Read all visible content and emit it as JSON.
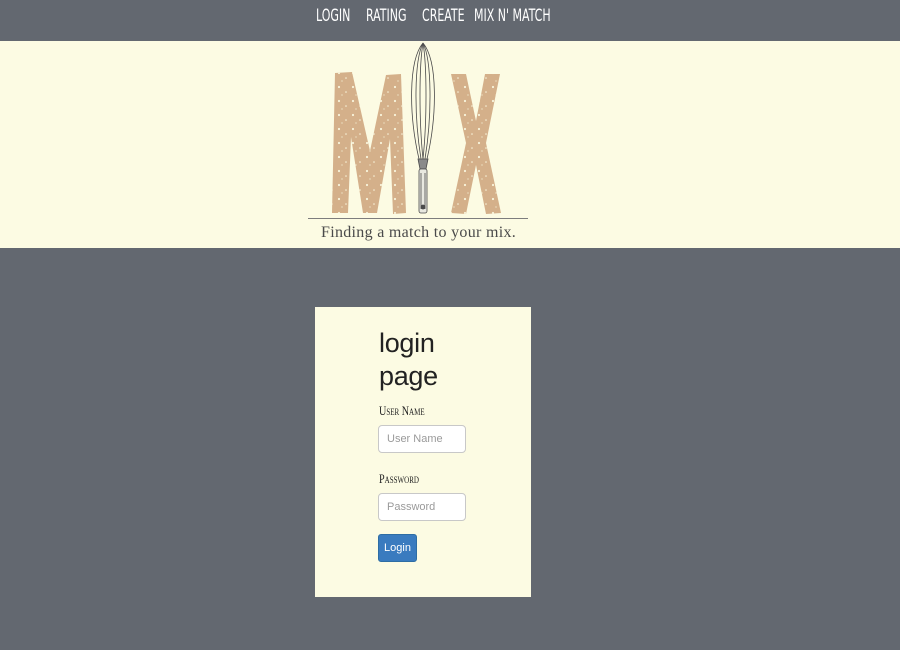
{
  "nav": {
    "items": [
      {
        "label": "LOGIN"
      },
      {
        "label": "RATING"
      },
      {
        "label": "CREATE"
      },
      {
        "label": "MIX N' MATCH"
      }
    ]
  },
  "banner": {
    "logo_text": "MIX",
    "tagline": "Finding a match to your mix."
  },
  "login": {
    "title": "login page",
    "username_label": "User Name",
    "username_placeholder": "User Name",
    "password_label": "Password",
    "password_placeholder": "Password",
    "button_label": "Login"
  },
  "colors": {
    "background": "#636870",
    "cream": "#fcfbe3",
    "logo_tan": "#d4b08a",
    "button_blue": "#3a7bbf"
  }
}
